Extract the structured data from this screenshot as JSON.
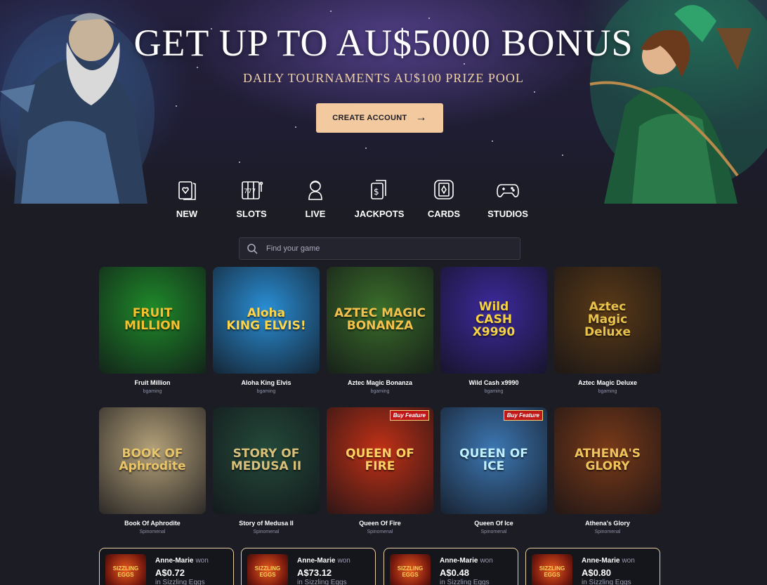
{
  "hero": {
    "title": "GET UP TO AU$5000 BONUS",
    "subtitle": "DAILY TOURNAMENTS AU$100 PRIZE POOL",
    "cta_label": "CREATE ACCOUNT"
  },
  "categories": [
    {
      "label": "NEW",
      "icon": "new-cards-icon"
    },
    {
      "label": "SLOTS",
      "icon": "slot-reels-icon"
    },
    {
      "label": "LIVE",
      "icon": "live-dealer-icon"
    },
    {
      "label": "JACKPOTS",
      "icon": "jackpot-cards-icon"
    },
    {
      "label": "CARDS",
      "icon": "card-diamond-icon"
    },
    {
      "label": "STUDIOS",
      "icon": "gamepad-icon"
    }
  ],
  "search": {
    "placeholder": "Find your game"
  },
  "games": [
    {
      "name": "Fruit Million",
      "provider": "bgaming",
      "art": "FRUIT\nMILLION",
      "bg": "#1f8a2a",
      "accent": "#f6c12f"
    },
    {
      "name": "Aloha King Elvis",
      "provider": "bgaming",
      "art": "Aloha\nKING ELVIS!",
      "bg": "#2a8fd6",
      "accent": "#ffd54a"
    },
    {
      "name": "Aztec Magic Bonanza",
      "provider": "bgaming",
      "art": "AZTEC MAGIC\nBONANZA",
      "bg": "#3a6e2a",
      "accent": "#f2c24d"
    },
    {
      "name": "Wild Cash x9990",
      "provider": "bgaming",
      "art": "Wild\nCASH\nX9990",
      "bg": "#3d2a9e",
      "accent": "#f5d342"
    },
    {
      "name": "Aztec Magic Deluxe",
      "provider": "bgaming",
      "art": "Aztec\nMagic\nDeluxe",
      "bg": "#5a3a17",
      "accent": "#e8c24a"
    },
    {
      "name": "Book Of Aphrodite",
      "provider": "Spinomenal",
      "art": "BOOK OF Aphrodite",
      "bg": "#b5a27a",
      "accent": "#e9c56a"
    },
    {
      "name": "Story of Medusa II",
      "provider": "Spinomenal",
      "art": "STORY OF\nMEDUSA II",
      "bg": "#244a3a",
      "accent": "#d8c07a"
    },
    {
      "name": "Queen Of Fire",
      "provider": "Spinomenal",
      "art": "QUEEN OF FIRE",
      "bg": "#c23116",
      "accent": "#ffd063",
      "badge": "Buy Feature"
    },
    {
      "name": "Queen Of Ice",
      "provider": "Spinomenal",
      "art": "QUEEN OF\nICE",
      "bg": "#3d78b4",
      "accent": "#bff0ff",
      "badge": "Buy Feature"
    },
    {
      "name": "Athena's Glory",
      "provider": "Spinomenal",
      "art": "ATHENA'S GLORY",
      "bg": "#7a3a18",
      "accent": "#f0c25a"
    }
  ],
  "wins": [
    {
      "player": "Anne-Marie",
      "word": "won",
      "amount": "A$0.72",
      "game": "in Sizzling Eggs",
      "art": "SIZZLING EGGS"
    },
    {
      "player": "Anne-Marie",
      "word": "won",
      "amount": "A$73.12",
      "game": "in Sizzling Eggs",
      "art": "SIZZLING EGGS"
    },
    {
      "player": "Anne-Marie",
      "word": "won",
      "amount": "A$0.48",
      "game": "in Sizzling Eggs",
      "art": "SIZZLING EGGS"
    },
    {
      "player": "Anne-Marie",
      "word": "won",
      "amount": "A$0.80",
      "game": "in Sizzling Eggs",
      "art": "SIZZLING EGGS"
    }
  ],
  "colors": {
    "background": "#1b1c24",
    "accent": "#f3c9a0",
    "win_border": "#e9cfa5"
  }
}
